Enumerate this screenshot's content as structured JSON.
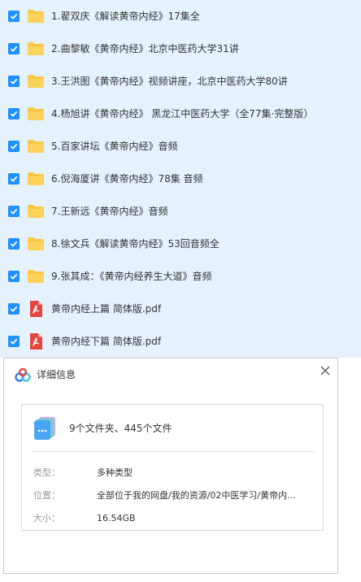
{
  "colors": {
    "list_background": "#e5f2fe",
    "checkbox": "#1e90ff",
    "folder": "#f9c843",
    "pdf": "#e5453a"
  },
  "files": [
    {
      "name": "1.翟双庆《解读黄帝内经》17集全",
      "type": "folder",
      "icon": "folder-icon",
      "checked": true
    },
    {
      "name": "2.曲黎敏《黄帝内经》北京中医药大学31讲",
      "type": "folder",
      "icon": "folder-icon",
      "checked": true
    },
    {
      "name": "3.王洪图《黄帝内经》视频讲座，北京中医药大学80讲",
      "type": "folder",
      "icon": "folder-icon",
      "checked": true
    },
    {
      "name": "4.杨旭讲《黄帝内经》 黑龙江中医药大学（全77集·完整版）",
      "type": "folder",
      "icon": "folder-icon",
      "checked": true
    },
    {
      "name": "5.百家讲坛《黄帝内经》音频",
      "type": "folder",
      "icon": "folder-icon",
      "checked": true
    },
    {
      "name": "6.倪海厦讲《黄帝内经》78集 音频",
      "type": "folder",
      "icon": "folder-icon",
      "checked": true
    },
    {
      "name": "7.王新远《黄帝内经》音频",
      "type": "folder",
      "icon": "folder-icon",
      "checked": true
    },
    {
      "name": "8.徐文兵《解读黄帝内经》53回音频全",
      "type": "folder",
      "icon": "folder-icon",
      "checked": true
    },
    {
      "name": "9.张其成：《黄帝内经养生大道》音频",
      "type": "folder",
      "icon": "folder-icon",
      "checked": true
    },
    {
      "name": "黄帝内经上篇 简体版.pdf",
      "type": "pdf",
      "icon": "pdf-icon",
      "checked": true
    },
    {
      "name": "黄帝内经下篇 简体版.pdf",
      "type": "pdf",
      "icon": "pdf-icon",
      "checked": true
    }
  ],
  "dialog": {
    "title": "详细信息",
    "logo_icon": "cloud-logo-icon",
    "close_icon": "close-icon",
    "summary": "9个文件夹、445个文件",
    "summary_icon": "multi-file-icon",
    "details": [
      {
        "label": "类型：",
        "value": "多种类型"
      },
      {
        "label": "位置：",
        "value": "全部位于我的网盘/我的资源/02中医学习/黄帝内..."
      },
      {
        "label": "大小：",
        "value": "16.54GB"
      }
    ]
  }
}
